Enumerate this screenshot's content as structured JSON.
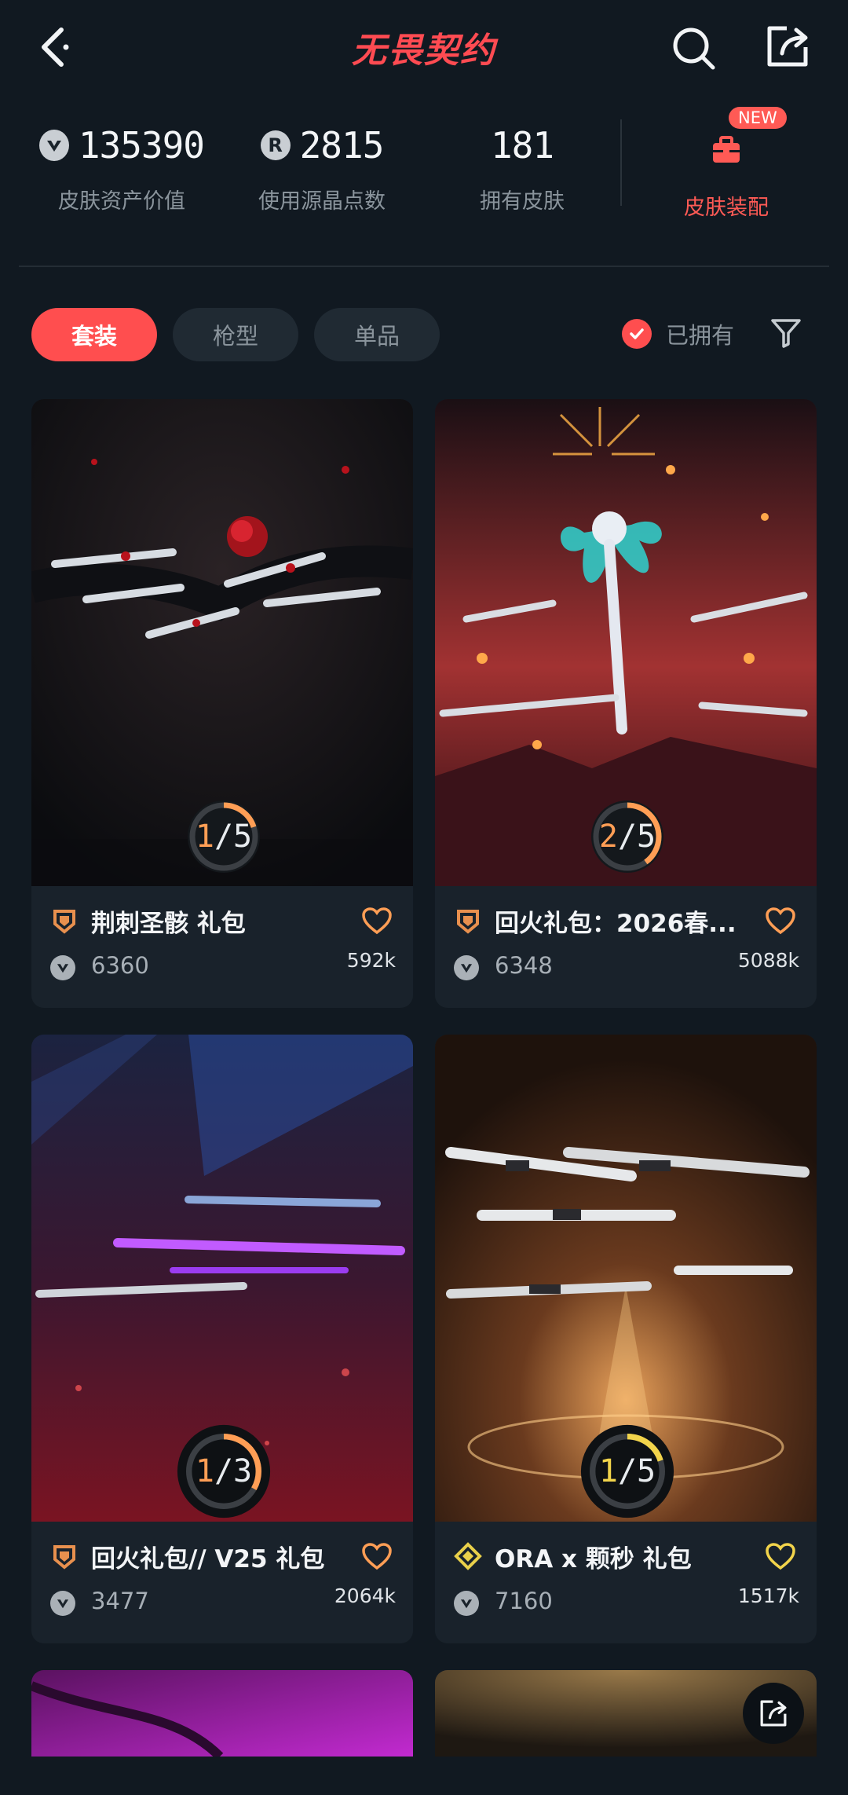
{
  "header": {
    "logo_text": "无畏契约"
  },
  "stats": {
    "skin_value": {
      "number": "135390",
      "label": "皮肤资产价值"
    },
    "radianite": {
      "number": "2815",
      "label": "使用源晶点数",
      "icon_letter": "R"
    },
    "owned_skins": {
      "number": "181",
      "label": "拥有皮肤"
    },
    "equip": {
      "label": "皮肤装配",
      "badge": "NEW"
    }
  },
  "tabs": [
    {
      "label": "套装",
      "active": true
    },
    {
      "label": "枪型",
      "active": false
    },
    {
      "label": "单品",
      "active": false
    }
  ],
  "owned_filter": {
    "label": "已拥有",
    "checked": true
  },
  "cards": [
    {
      "title": "荆刺圣骸 礼包",
      "price": "6360",
      "likes": "592k",
      "progress_current": "1",
      "progress_total": "5",
      "progress_fraction": 0.2,
      "tier_color": "#e8904e",
      "heart_color": "#ff9e55"
    },
    {
      "title": "回火礼包：2026春...",
      "price": "6348",
      "likes": "5088k",
      "progress_current": "2",
      "progress_total": "5",
      "progress_fraction": 0.4,
      "tier_color": "#e8904e",
      "heart_color": "#ff9e55"
    },
    {
      "title": "回火礼包// V25 礼包",
      "price": "3477",
      "likes": "2064k",
      "progress_current": "1",
      "progress_total": "3",
      "progress_fraction": 0.333,
      "tier_color": "#e8904e",
      "heart_color": "#ff9e55"
    },
    {
      "title": "ORA x 颗秒 礼包",
      "price": "7160",
      "likes": "1517k",
      "progress_current": "1",
      "progress_total": "5",
      "progress_fraction": 0.2,
      "tier_color": "#e9d04a",
      "heart_color": "#f2d44b"
    }
  ],
  "colors": {
    "accent": "#ff4e4f",
    "background": "#111921",
    "card": "#19222b",
    "progress_orange": "#ff9e55",
    "progress_yellow": "#f2d44b"
  }
}
